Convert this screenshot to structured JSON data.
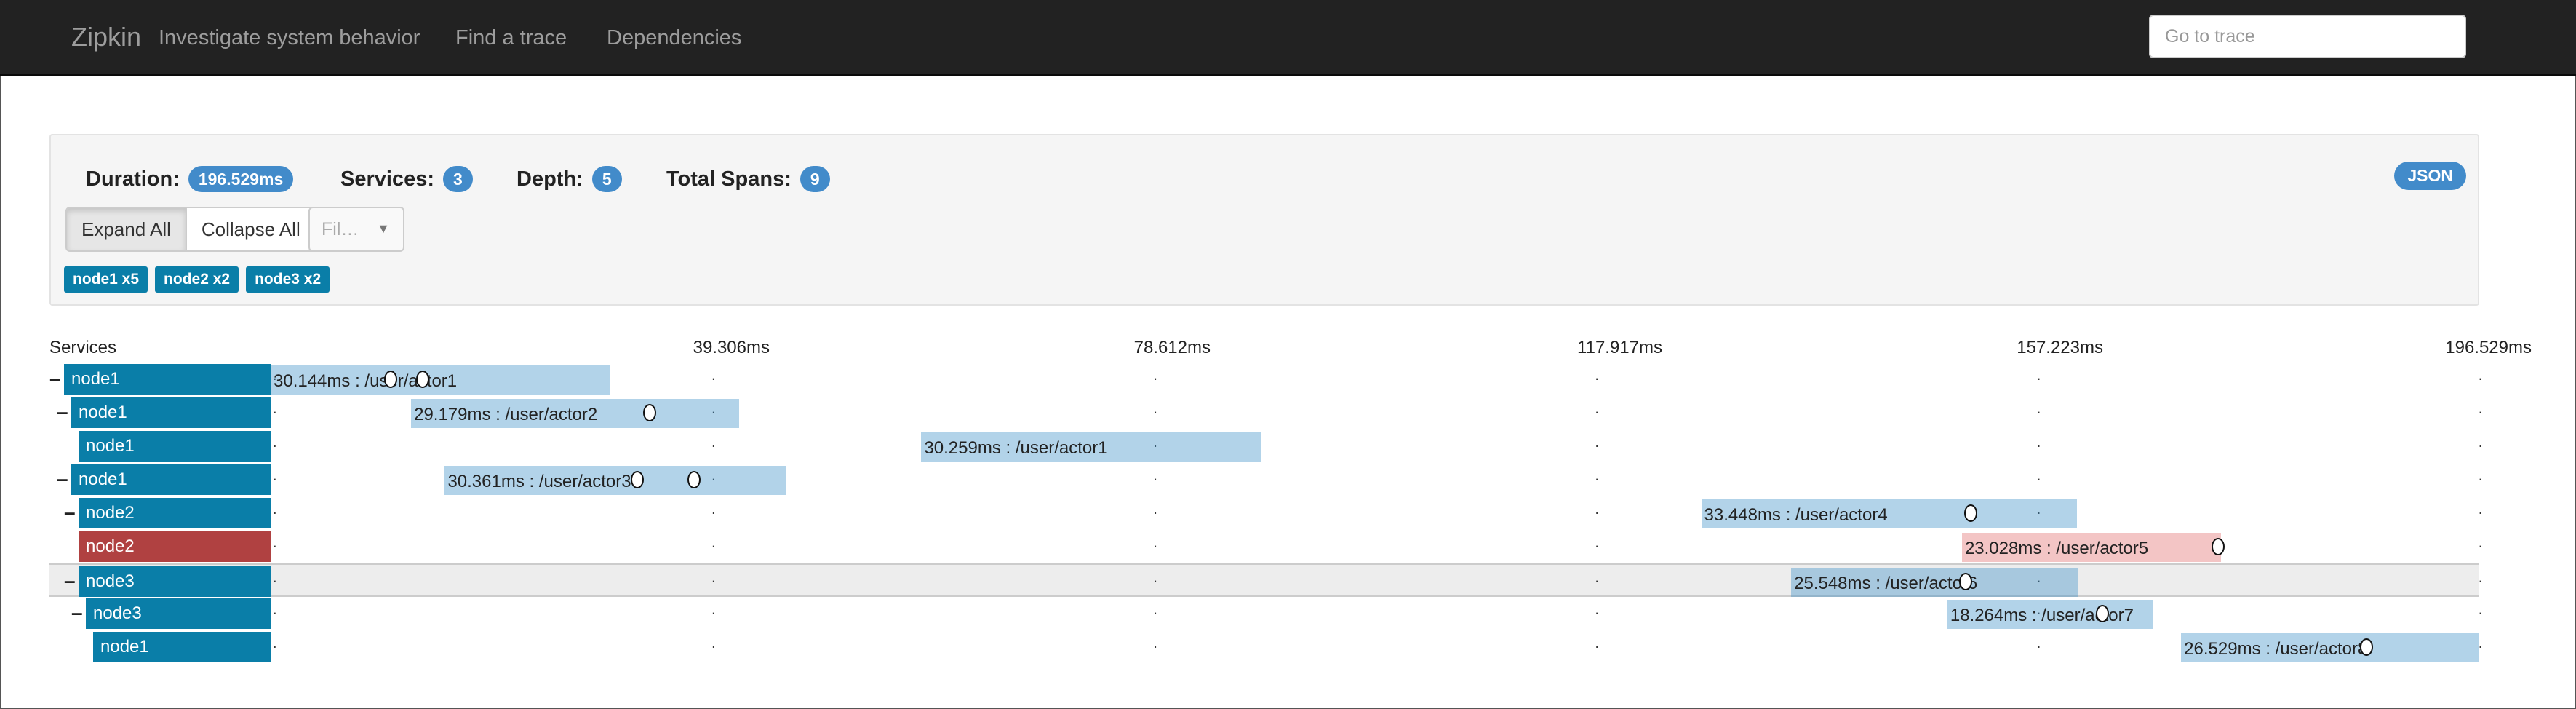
{
  "nav": {
    "brand": "Zipkin",
    "tagline": "Investigate system behavior",
    "links": [
      "Find a trace",
      "Dependencies"
    ],
    "search_placeholder": "Go to trace"
  },
  "summary": {
    "duration_label": "Duration:",
    "duration_value": "196.529ms",
    "services_label": "Services:",
    "services_value": "3",
    "depth_label": "Depth:",
    "depth_value": "5",
    "spans_label": "Total Spans:",
    "spans_value": "9",
    "json_label": "JSON",
    "expand_label": "Expand All",
    "collapse_label": "Collapse All",
    "filter_placeholder": "Fil…",
    "service_badges": [
      "node1 x5",
      "node2 x2",
      "node3 x2"
    ]
  },
  "timeline": {
    "services_header": "Services",
    "ticks": [
      "39.306ms",
      "78.612ms",
      "117.917ms",
      "157.223ms",
      "196.529ms"
    ],
    "total_ms": 196.529,
    "rows": [
      {
        "toggle": "–",
        "service": "node1",
        "label": "30.144ms : /user/actor1",
        "start_ms": 0,
        "duration_ms": 30.144,
        "error": false,
        "selected": false,
        "annotations_ms": [
          10.7,
          13.5
        ]
      },
      {
        "toggle": "–",
        "service": "node1",
        "label": "29.179ms : /user/actor2",
        "start_ms": 12.5,
        "duration_ms": 29.179,
        "error": false,
        "selected": false,
        "annotations_ms": [
          33.7
        ]
      },
      {
        "toggle": "",
        "service": "node1",
        "label": "30.259ms : /user/actor1",
        "start_ms": 57.9,
        "duration_ms": 30.259,
        "error": false,
        "selected": false,
        "annotations_ms": []
      },
      {
        "toggle": "–",
        "service": "node1",
        "label": "30.361ms : /user/actor3",
        "start_ms": 15.5,
        "duration_ms": 30.361,
        "error": false,
        "selected": false,
        "annotations_ms": [
          32.6,
          37.7
        ]
      },
      {
        "toggle": "–",
        "service": "node2",
        "label": "33.448ms : /user/actor4",
        "start_ms": 127.3,
        "duration_ms": 33.448,
        "error": false,
        "selected": false,
        "annotations_ms": [
          151.3
        ]
      },
      {
        "toggle": "",
        "service": "node2",
        "label": "23.028ms : /user/actor5",
        "start_ms": 150.5,
        "duration_ms": 23.028,
        "error": true,
        "selected": false,
        "annotations_ms": [
          173.3
        ]
      },
      {
        "toggle": "–",
        "service": "node3",
        "label": "25.548ms : /user/actor6",
        "start_ms": 135.3,
        "duration_ms": 25.548,
        "error": false,
        "selected": true,
        "annotations_ms": [
          150.8
        ]
      },
      {
        "toggle": "–",
        "service": "node3",
        "label": "18.264ms : /user/actor7",
        "start_ms": 149.2,
        "duration_ms": 18.264,
        "error": false,
        "selected": false,
        "annotations_ms": [
          163.0
        ]
      },
      {
        "toggle": "",
        "service": "node1",
        "label": "26.529ms : /user/actor8",
        "start_ms": 170.0,
        "duration_ms": 26.529,
        "error": false,
        "selected": false,
        "annotations_ms": [
          186.5
        ]
      }
    ]
  },
  "colors": {
    "navbar": "#222222",
    "service": "#0a7ea8",
    "service_error": "#b04141",
    "span": "#3e91c8",
    "badge": "#428bca"
  }
}
